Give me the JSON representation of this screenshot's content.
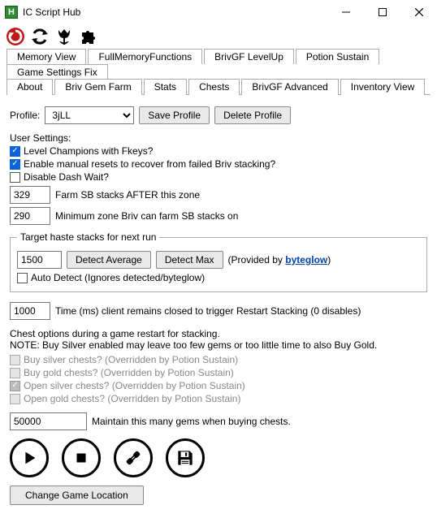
{
  "window": {
    "title": "IC Script Hub",
    "icon_letter": "H",
    "min_tooltip": "Minimize",
    "max_tooltip": "Maximize",
    "close_tooltip": "Close"
  },
  "tabs_row1": [
    {
      "label": "Memory View"
    },
    {
      "label": "FullMemoryFunctions"
    },
    {
      "label": "BrivGF LevelUp"
    },
    {
      "label": "Potion Sustain"
    },
    {
      "label": "Game Settings Fix"
    }
  ],
  "tabs_row2": [
    {
      "label": "About"
    },
    {
      "label": "Briv Gem Farm",
      "active": true
    },
    {
      "label": "Stats"
    },
    {
      "label": "Chests"
    },
    {
      "label": "BrivGF Advanced"
    },
    {
      "label": "Inventory View"
    }
  ],
  "profile": {
    "label": "Profile:",
    "value": "3jLL",
    "save": "Save Profile",
    "delete": "Delete Profile"
  },
  "settings_header": "User Settings:",
  "cb_level_fkeys": {
    "label": "Level Champions with Fkeys?",
    "checked": true
  },
  "cb_manual_resets": {
    "label": "Enable manual resets to recover from failed Briv stacking?",
    "checked": true
  },
  "cb_disable_dash": {
    "label": "Disable Dash Wait?",
    "checked": false
  },
  "sb_after": {
    "value": "329",
    "label": "Farm SB stacks AFTER this zone"
  },
  "sb_min": {
    "value": "290",
    "label": "Minimum zone Briv can farm SB stacks on"
  },
  "haste_group": {
    "legend": "Target haste stacks for next run",
    "value": "1500",
    "detect_avg": "Detect Average",
    "detect_max": "Detect Max",
    "provided_prefix": "(Provided by ",
    "provided_link": "byteglow",
    "provided_suffix": ")",
    "autodetect": {
      "label": "Auto Detect (Ignores detected/byteglow)",
      "checked": false
    }
  },
  "restart_ms": {
    "value": "1000",
    "label": "Time (ms) client remains closed to trigger Restart Stacking (0 disables)"
  },
  "chest_note1": "Chest options during a game restart for stacking.",
  "chest_note2": "NOTE: Buy Silver enabled may leave too few gems or too little time to also Buy Gold.",
  "cb_buy_silver": {
    "label": "Buy silver chests? (Overridden by Potion Sustain)",
    "checked": false
  },
  "cb_buy_gold": {
    "label": "Buy gold chests? (Overridden by Potion Sustain)",
    "checked": false
  },
  "cb_open_silver": {
    "label": "Open silver chests? (Overridden by Potion Sustain)",
    "checked": true
  },
  "cb_open_gold": {
    "label": "Open gold chests? (Overridden by Potion Sustain)",
    "checked": false
  },
  "maintain_gems": {
    "value": "50000",
    "label": "Maintain this many gems when buying chests."
  },
  "change_loc": "Change Game Location"
}
